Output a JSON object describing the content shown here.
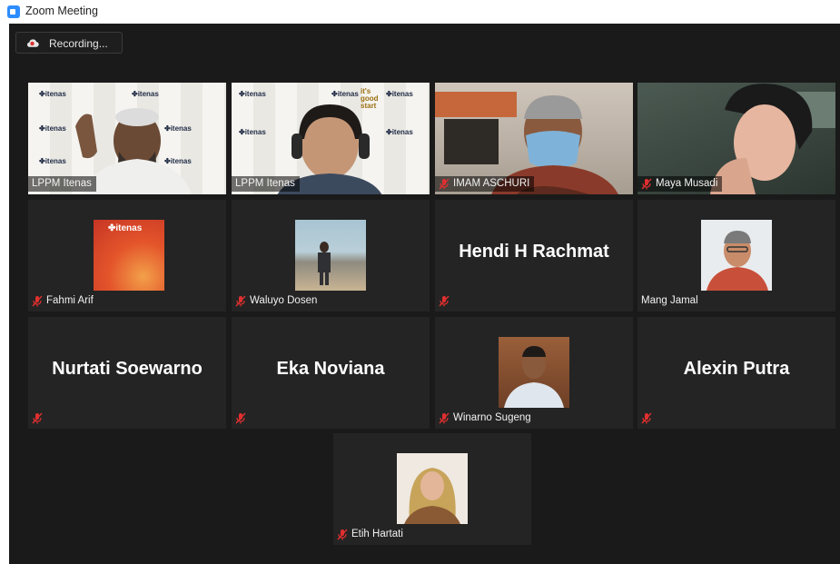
{
  "window": {
    "title": "Zoom Meeting"
  },
  "recording": {
    "label": "Recording..."
  },
  "backdrop": {
    "brand": "✤itenas",
    "slogan_1": "it's",
    "slogan_2": "good",
    "slogan_3": "start"
  },
  "participants": [
    {
      "name": "LPPM Itenas",
      "muted": false,
      "video": true,
      "active_speaker": true
    },
    {
      "name": "LPPM Itenas",
      "muted": false,
      "video": true
    },
    {
      "name": "IMAM ASCHURI",
      "muted": true,
      "video": true
    },
    {
      "name": "Maya Musadi",
      "muted": true,
      "video": true
    },
    {
      "name": "Fahmi Arif",
      "muted": true,
      "video": false,
      "avatar_text": "✤itenas"
    },
    {
      "name": "Waluyo Dosen",
      "muted": true,
      "video": false
    },
    {
      "name": "Hendi H Rachmat",
      "muted": true,
      "video": false
    },
    {
      "name": "Mang Jamal",
      "muted": false,
      "video": false
    },
    {
      "name": "Nurtati Soewarno",
      "muted": true,
      "video": false
    },
    {
      "name": "Eka Noviana",
      "muted": true,
      "video": false
    },
    {
      "name": "Winarno Sugeng",
      "muted": true,
      "video": false
    },
    {
      "name": "Alexin Putra",
      "muted": true,
      "video": false
    },
    {
      "name": "Etih Hartati",
      "muted": true,
      "video": false
    }
  ],
  "colors": {
    "stage": "#1a1a1a",
    "tile": "#242424",
    "active_border": "#d6ee76",
    "muted_icon": "#e02f2f"
  }
}
